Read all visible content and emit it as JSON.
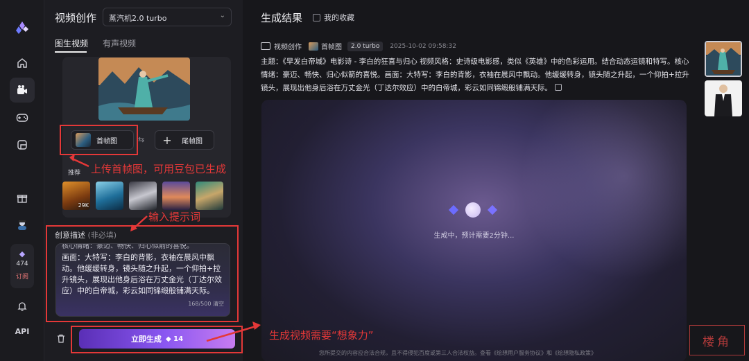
{
  "rail": {
    "subscription_count": "474",
    "subscription_label": "订阅",
    "api_label": "API"
  },
  "panel": {
    "title": "视频创作",
    "model_select": "蒸汽机2.0 turbo",
    "tabs": [
      "图生视频",
      "有声视频"
    ],
    "first_frame_label": "首帧图",
    "last_frame_label": "尾帧图",
    "recommend_label": "推荐",
    "recommend_count": "29K",
    "description_label": "创意描述",
    "description_optional": "(非必填)",
    "textarea_cut_line": "核心情绪：豪迈、畅快、归心似箭的喜悦。",
    "textarea_value": "画面：大特写：李白的背影，衣袖在晨风中飘动。他缓缓转身，镜头随之升起，一个仰拍+拉升镜头，展现出他身后浴在万丈金光（丁达尔效应）中的白帝城，彩云如同锦缎般铺满天际。",
    "char_counter": "168/500",
    "clear_label": "清空",
    "generate_label": "立即生成",
    "generate_cost": "14"
  },
  "main": {
    "title": "生成结果",
    "favorites_label": "我的收藏",
    "meta_type": "视频创作",
    "meta_mode": "首帧图",
    "meta_model": "2.0 turbo",
    "meta_time": "2025-10-02 09:58:32",
    "prompt": "主题：《早发白帝城》电影诗 - 李白的狂喜与归心 视频风格：史诗级电影感，类似《英雄》中的色彩运用。结合动态运镜和特写。核心情绪：豪迈、畅快、归心似箭的喜悦。画面：大特写：李白的背影，衣袖在晨风中飘动。他缓缓转身，镜头随之升起，一个仰拍+拉升镜头，展现出他身后浴在万丈金光（丁达尔效应）中的白帝城，彩云如同锦缎般铺满天际。",
    "generating_text": "生成中，预计需要2分钟...",
    "footer": "您所提交的内容应合法合规，且不得侵犯百度或第三人合法权益。查看《绘想用户服务协议》和《绘想隐私政策》"
  },
  "annotations": {
    "a1": "上传首帧图，可用豆包已生成",
    "a2": "输入提示词",
    "a3": "生成视频需要“想象力”"
  },
  "colors": {
    "accent": "#8a57f1",
    "annotation_red": "#e43838",
    "background": "#17171b"
  }
}
